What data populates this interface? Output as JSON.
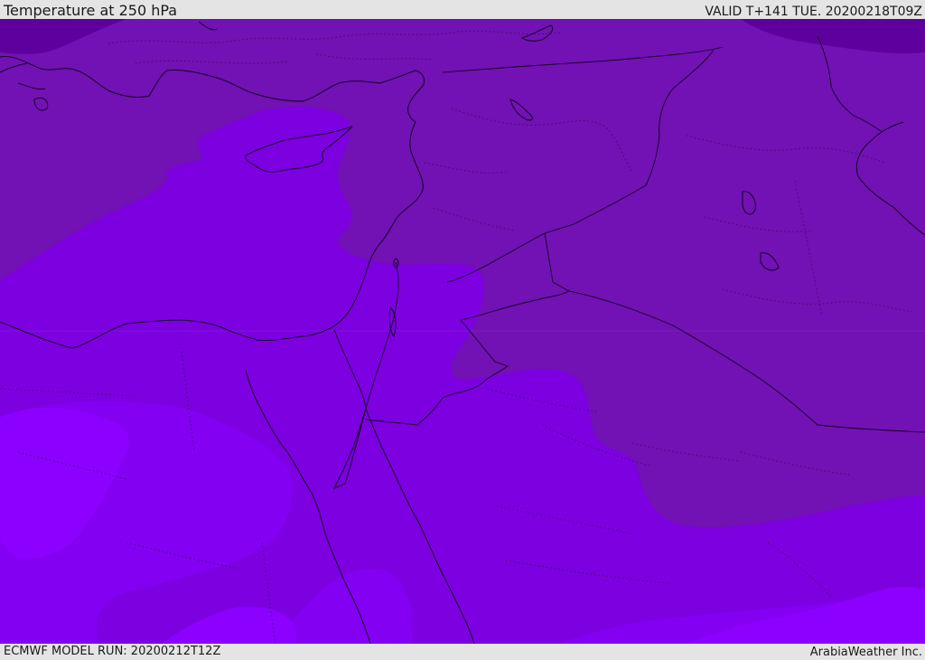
{
  "header": {
    "title": "Temperature at 250 hPa",
    "valid": "VALID T+141 TUE. 20200218T09Z"
  },
  "footer": {
    "model_run": "ECMWF MODEL RUN: 20200212T12Z",
    "brand": "ArabiaWeather Inc."
  },
  "colors": {
    "band_warmest": "#5e009e",
    "band_warm": "#7211b4",
    "band_mid": "#7c00e0",
    "band_cool": "#8300f2",
    "band_coldest": "#8b00ff",
    "coastline": "#120020"
  }
}
